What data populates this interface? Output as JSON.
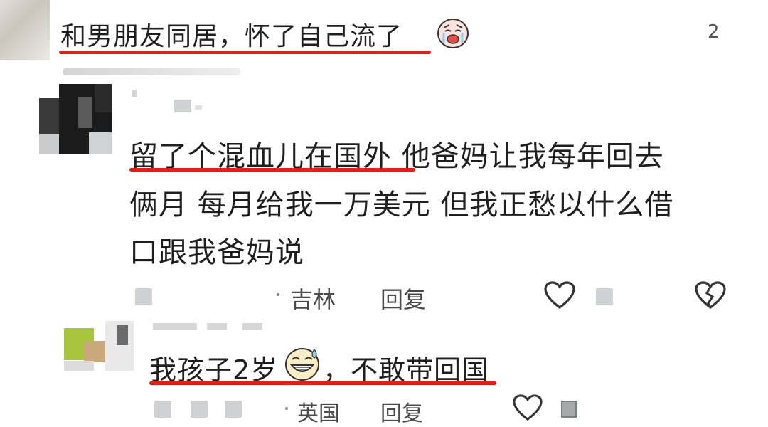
{
  "comment1": {
    "text": "和男朋友同居，怀了自己流了",
    "like_count": "2"
  },
  "comment2": {
    "text_line1_highlight": "留了个混血儿在国外",
    "text_line1_rest": " 他爸妈让我每年回去",
    "text_line2": "俩月 每月给我一万美元 但我正愁以什么借",
    "text_line3": "口跟我爸妈说",
    "location": "吉林",
    "reply_label": "回复"
  },
  "reply1": {
    "text_before_emoji": "我孩子2岁",
    "text_after_emoji": "，不敢带回国",
    "location": "英国",
    "reply_label": "回复"
  },
  "colors": {
    "underline": "#e0211b",
    "text": "#1f1f1f",
    "meta": "#4a4a4a"
  },
  "icons": [
    "crying-face-emoji",
    "sweat-smile-emoji",
    "heart-icon",
    "broken-heart-icon"
  ]
}
